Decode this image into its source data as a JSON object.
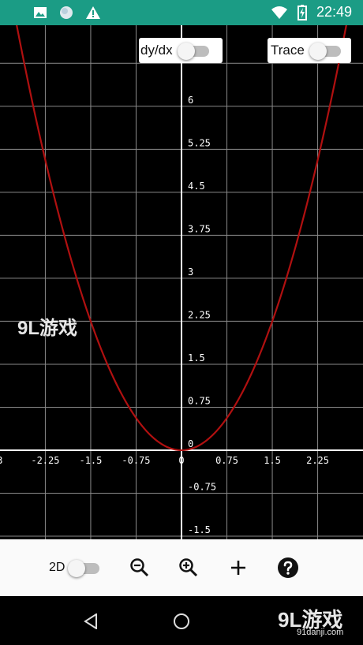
{
  "status_bar": {
    "time": "22:49",
    "left_icons": [
      "image-icon",
      "circle-icon",
      "warning-icon"
    ],
    "right_icons": [
      "wifi-icon",
      "battery-charging-icon"
    ],
    "background": "#1b9c85"
  },
  "controls": {
    "dydx_label": "dy/dx",
    "dydx_on": false,
    "trace_label": "Trace",
    "trace_on": false
  },
  "graph": {
    "x_tick_labels": [
      "3",
      "-2.25",
      "-1.5",
      "-0.75",
      "0",
      "0.75",
      "1.5",
      "2.25"
    ],
    "y_tick_labels": [
      "6",
      "5.25",
      "4.5",
      "3.75",
      "3",
      "2.25",
      "1.5",
      "0.75",
      "0",
      "-0.75",
      "-1.5"
    ],
    "curve_color": "#b01010",
    "grid_color": "#8a8a8a",
    "axis_color": "#ffffff"
  },
  "chart_data": {
    "type": "line",
    "series": [
      {
        "x": [
          -3,
          -2.25,
          -1.5,
          -0.75,
          0,
          0.75,
          1.5,
          2.25,
          3
        ],
        "y": [
          9,
          5.0625,
          2.25,
          0.5625,
          0,
          0.5625,
          2.25,
          5.0625,
          9
        ]
      }
    ],
    "xlim": [
      -3,
      3
    ],
    "ylim": [
      -1.8,
      8.2
    ],
    "grid": true
  },
  "toolbar": {
    "mode_label": "2D",
    "mode_on": false,
    "icons": [
      "zoom-out-icon",
      "zoom-in-icon",
      "add-icon",
      "help-icon"
    ]
  },
  "navigation": {
    "icons": [
      "back-icon",
      "home-icon"
    ]
  },
  "watermark": {
    "brand": "9L游戏",
    "site": "91danji.com"
  }
}
